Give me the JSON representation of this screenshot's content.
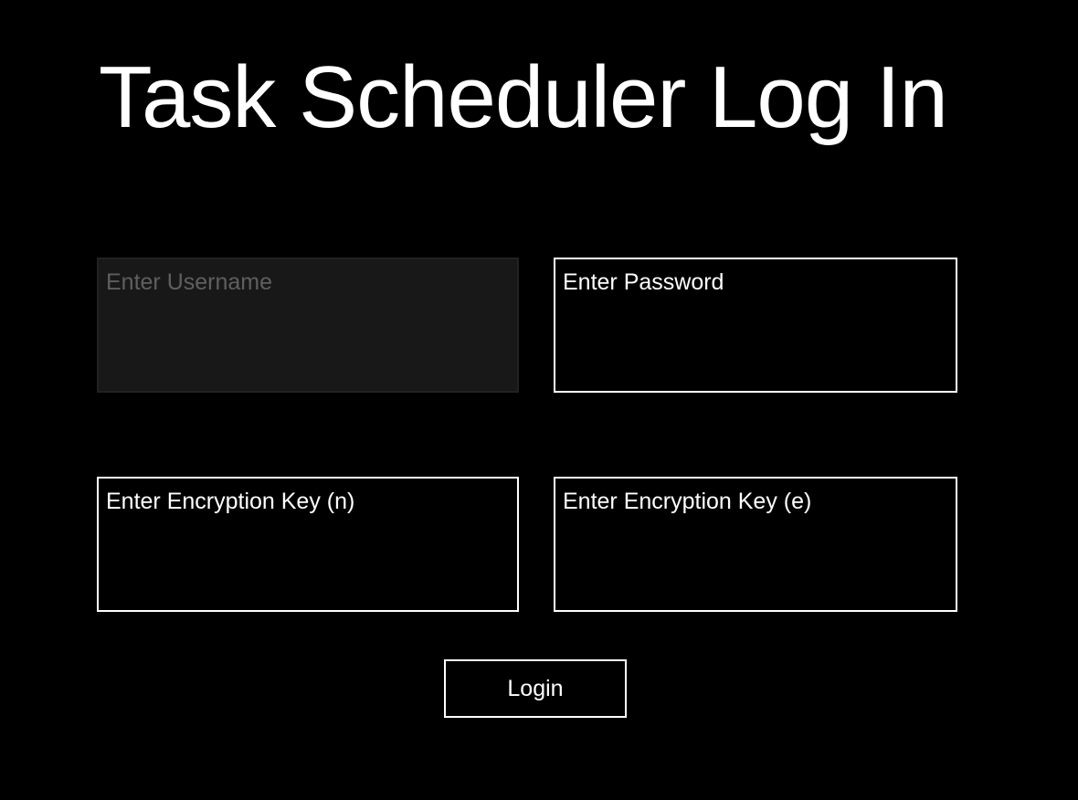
{
  "page": {
    "title": "Task Scheduler Log In"
  },
  "form": {
    "username": {
      "placeholder": "Enter Username",
      "value": "",
      "disabled": true
    },
    "password": {
      "placeholder": "Enter Password",
      "value": ""
    },
    "key_n": {
      "placeholder": "Enter Encryption Key (n)",
      "value": ""
    },
    "key_e": {
      "placeholder": "Enter Encryption Key (e)",
      "value": ""
    },
    "login_label": "Login"
  },
  "colors": {
    "background": "#000000",
    "foreground": "#ffffff",
    "disabled_background": "#181818",
    "disabled_text": "#5f5f5f"
  }
}
